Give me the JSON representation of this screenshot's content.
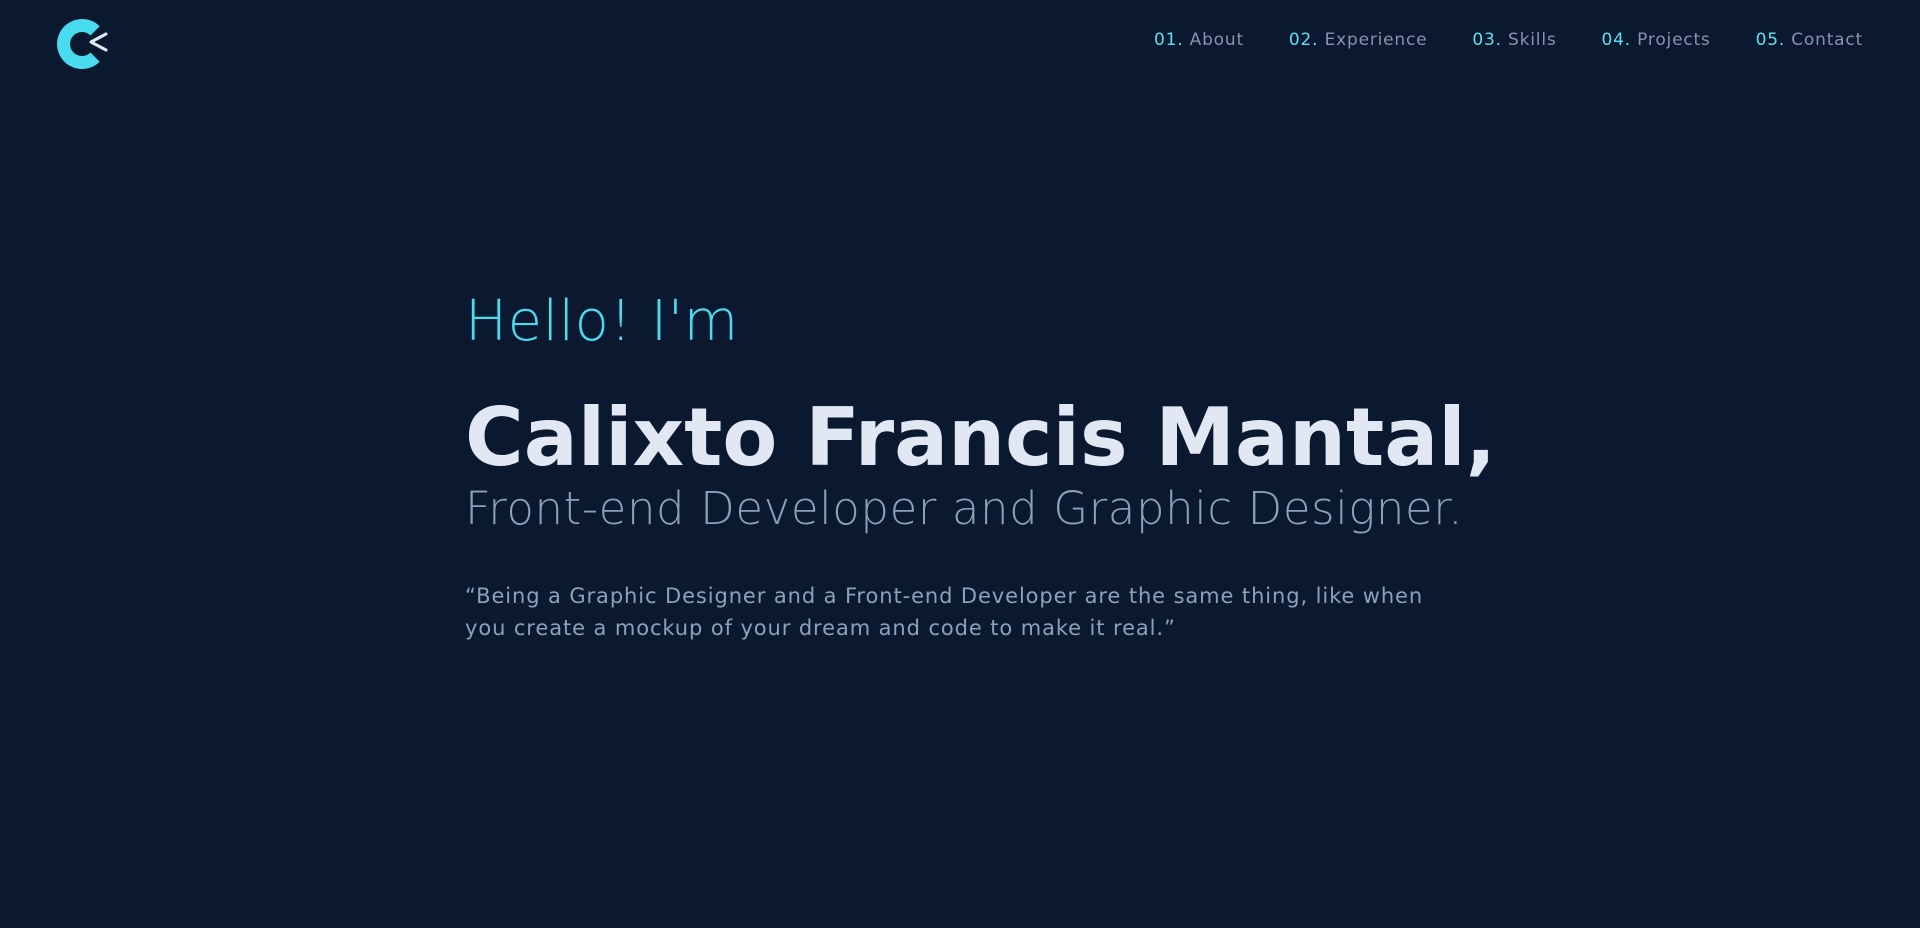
{
  "header": {
    "logo_icon": "c-logo-icon",
    "nav": [
      {
        "num": "01.",
        "label": "About"
      },
      {
        "num": "02.",
        "label": "Experience"
      },
      {
        "num": "03.",
        "label": "Skills"
      },
      {
        "num": "04.",
        "label": "Projects"
      },
      {
        "num": "05.",
        "label": "Contact"
      }
    ]
  },
  "hero": {
    "greeting": "Hello! I'm",
    "name": "Calixto Francis Mantal,",
    "role": "Front-end Developer and Graphic Designer.",
    "quote": "“Being a Graphic Designer and a Front-end Developer are the same thing, like when you create a mockup of your dream and code to make it real.”"
  },
  "colors": {
    "background": "#0a1930",
    "accent": "#49dbee",
    "heading": "#e2e8f3",
    "muted": "#8ea0b9"
  }
}
